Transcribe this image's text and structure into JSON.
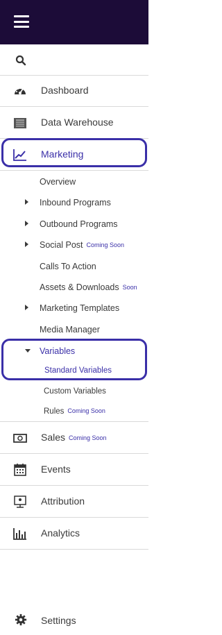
{
  "sidebar": {
    "search_icon": "search-icon",
    "items": [
      {
        "label": "Dashboard",
        "icon": "dashboard-icon"
      },
      {
        "label": "Data Warehouse",
        "icon": "data-warehouse-icon"
      },
      {
        "label": "Marketing",
        "icon": "marketing-chart-icon",
        "active": true
      },
      {
        "label": "Sales",
        "badge": "Coming Soon",
        "icon": "sales-money-icon"
      },
      {
        "label": "Events",
        "icon": "calendar-icon"
      },
      {
        "label": "Attribution",
        "icon": "attribution-icon"
      },
      {
        "label": "Analytics",
        "icon": "analytics-bar-icon"
      }
    ],
    "marketing_sub": [
      {
        "label": "Overview"
      },
      {
        "label": "Inbound Programs",
        "expandable": true
      },
      {
        "label": "Outbound Programs",
        "expandable": true
      },
      {
        "label": "Social Post",
        "badge": "Coming Soon",
        "expandable": true
      },
      {
        "label": "Calls To Action"
      },
      {
        "label": "Assets & Downloads",
        "badge": "Soon"
      },
      {
        "label": "Marketing Templates",
        "expandable": true
      },
      {
        "label": "Media Manager"
      },
      {
        "label": "Variables",
        "expanded": true,
        "active": true
      }
    ],
    "variables_sub": [
      {
        "label": "Standard Variables",
        "active": true
      },
      {
        "label": "Custom Variables"
      },
      {
        "label": "Rules",
        "badge": "Coming Soon"
      }
    ],
    "settings": {
      "label": "Settings",
      "icon": "gear-icon"
    }
  },
  "colors": {
    "topbar": "#1c0c38",
    "accent": "#3a2fa8",
    "divider": "#d9d9d9"
  }
}
